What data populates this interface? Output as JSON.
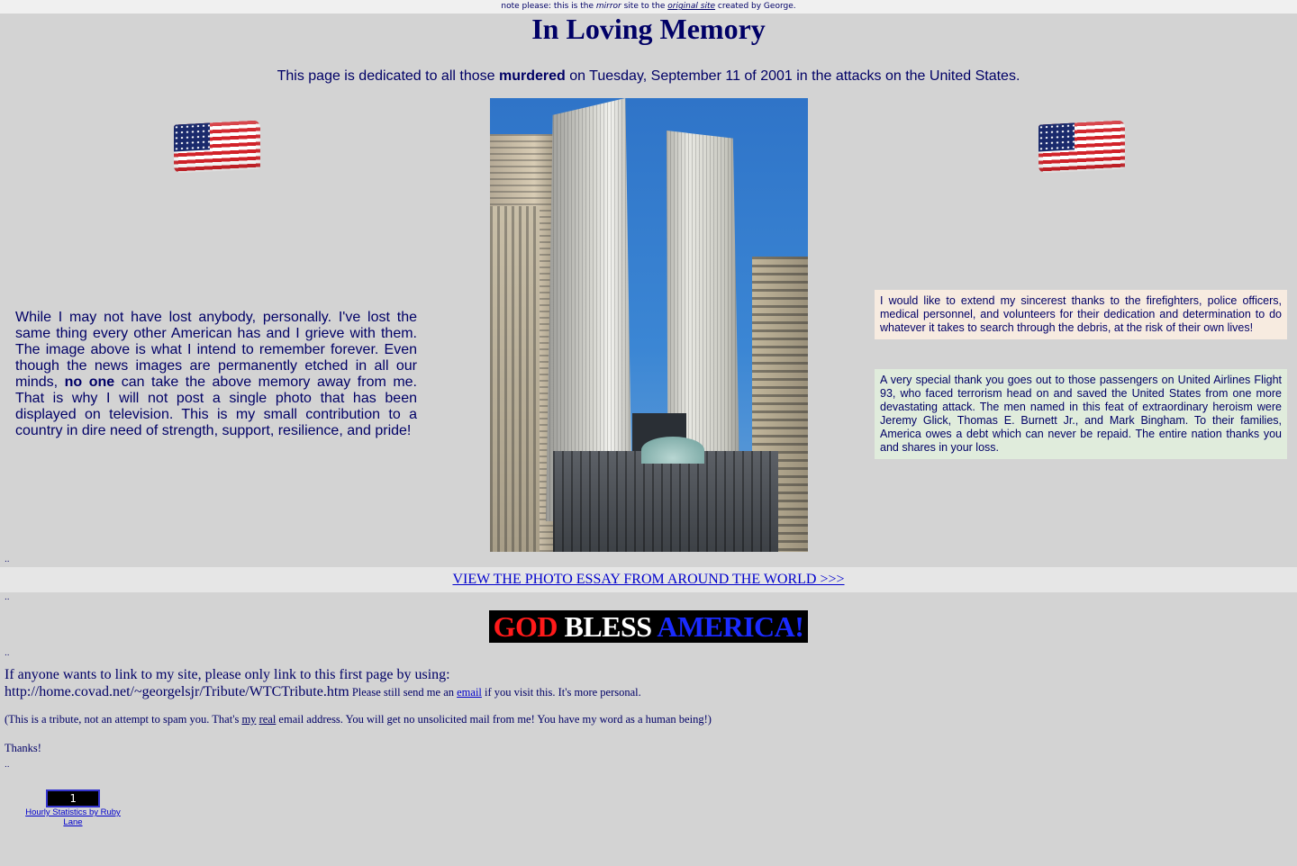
{
  "top_note": {
    "before": "note please: this is the ",
    "mirror": "mirror",
    "middle": " site to the ",
    "original_link": "original site",
    "after": " created by George."
  },
  "title": "In Loving Memory",
  "dedication": {
    "before": "This page is dedicated to all those ",
    "bold": "murdered",
    "after": " on Tuesday, September 11 of 2001 in the attacks on the United States."
  },
  "left_paragraph": {
    "before": "While I may not have lost anybody, personally.  I've lost the same thing every other American has and I grieve with them.  The image above is what I intend to remember forever.  Even though the news images are permanently etched in all our minds, ",
    "bold": "no one",
    "after": " can take the above memory away from me.  That is why I will not post a single photo that has been displayed on television.  This is my small contribution to a country in dire need of strength, support, resilience, and pride!"
  },
  "thanks_box": "I would like to extend my sincerest thanks to the firefighters, police officers, medical personnel, and volunteers for their dedication and determination to do whatever it takes to search through the debris, at the risk of their own lives!",
  "flight93_box": "A very special thank you goes out to those passengers on United Airlines Flight 93, who faced terrorism head on and saved the United States from one more devastating attack.  The men named in this feat of extraordinary heroism were Jeremy Glick, Thomas E. Burnett Jr., and Mark Bingham.  To their families, America owes a debt which can never be repaid.  The entire nation thanks you and shares in your loss.",
  "separator": "..",
  "photo_essay_link": "VIEW THE PHOTO ESSAY FROM AROUND THE WORLD >>>  ",
  "god_bless": {
    "word1": "GOD",
    "word2": "BLESS",
    "word3": "AMERICA!",
    "colors": {
      "red": "#ff1a1a",
      "white": "#ffffff",
      "blue": "#1a2bff"
    }
  },
  "link_info": {
    "line1": "If anyone wants to link to my site, please only link to this first page by using:",
    "url": "http://home.covad.net/~georgelsjr/Tribute/WTCTribute.htm",
    "after_url": " Please still send me an ",
    "email_link": "email",
    "after_email": " if you visit this.  It's more personal."
  },
  "disclaimer": {
    "before": "(This is a tribute, not an attempt to spam you.  That's ",
    "my": "my",
    "real": "real",
    "after": " email address.  You will get no unsolicited mail from me!  You have my word as a human being!)"
  },
  "thanks": "Thanks!",
  "counter": {
    "value": "1",
    "link": "Hourly Statistics by Ruby Lane"
  },
  "colors": {
    "background": "#d3d3d3",
    "text": "#000066",
    "link": "#0000cc",
    "thanks_box_bg": "#f7ebe0",
    "flight93_box_bg": "#e0ecdc"
  }
}
